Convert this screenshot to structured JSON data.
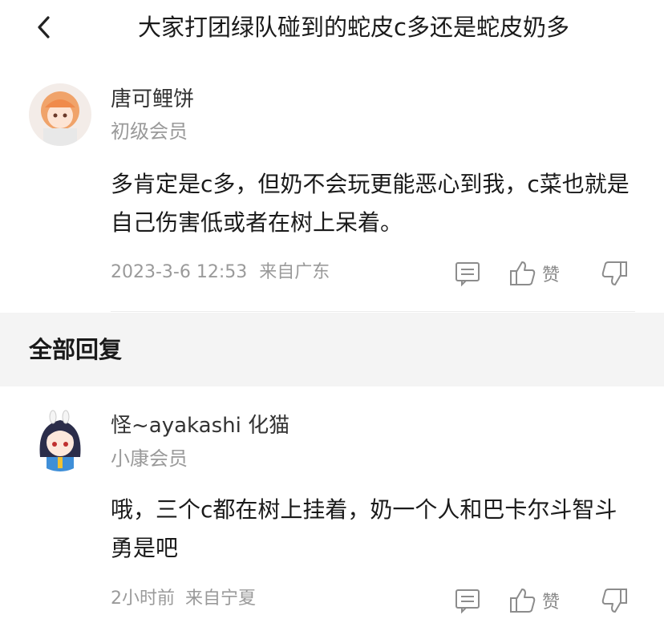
{
  "header": {
    "title": "大家打团绿队碰到的蛇皮c多还是蛇皮奶多"
  },
  "main_post": {
    "username": "唐可鲤饼",
    "rank": "初级会员",
    "content": "多肯定是c多，但奶不会玩更能恶心到我，c菜也就是自己伤害低或者在树上呆着。",
    "time": "2023-3-6 12:53",
    "location": "来自广东",
    "like_label": "赞"
  },
  "section": {
    "title": "全部回复"
  },
  "replies": [
    {
      "username": "怪~ayakashi 化猫",
      "rank": "小康会员",
      "content": "哦，三个c都在树上挂着，奶一个人和巴卡尔斗智斗勇是吧",
      "time": "2小时前",
      "location": "来自宁夏",
      "like_label": "赞"
    }
  ],
  "colors": {
    "text_primary": "#1a1a1a",
    "text_secondary": "#9a9a9a",
    "section_background": "#f4f4f4",
    "icon": "#8c8c8c"
  },
  "icons": [
    "back-icon",
    "comment-icon",
    "thumbs-up-icon",
    "thumbs-down-icon"
  ]
}
